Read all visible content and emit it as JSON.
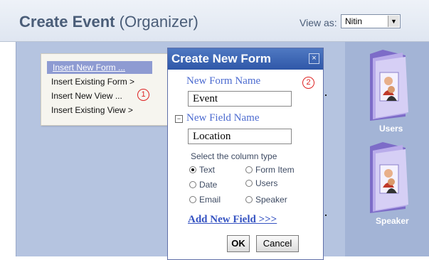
{
  "header": {
    "title_bold": "Create Event",
    "title_rest": " (Organizer)",
    "view_as_label": "View as:",
    "view_as_value": "Nitin"
  },
  "menu": {
    "items": [
      {
        "label": "Insert New Form ..."
      },
      {
        "label": "Insert Existing Form >"
      },
      {
        "label": "Insert New View ..."
      },
      {
        "label": "Insert Existing View >"
      }
    ],
    "callout": "1"
  },
  "dialog": {
    "title": "Create New Form",
    "close_glyph": "×",
    "callout": "2",
    "form_name_label": "New Form Name",
    "form_name_value": "Event",
    "field_name_label": "New Field Name",
    "field_name_value": "Location",
    "column_type_label": "Select the column type",
    "types": [
      {
        "label": "Text",
        "checked": true
      },
      {
        "label": "Form Item",
        "checked": false
      },
      {
        "label": "Date",
        "checked": false
      },
      {
        "label": "Users",
        "checked": false
      },
      {
        "label": "Email",
        "checked": false
      },
      {
        "label": "Speaker",
        "checked": false
      }
    ],
    "add_field_link": "Add New Field >>>",
    "ok_label": "OK",
    "cancel_label": "Cancel"
  },
  "sidebar": {
    "folders": [
      {
        "label": "Users",
        "icon": "users-folder-icon"
      },
      {
        "label": "Speaker",
        "icon": "speaker-folder-icon"
      }
    ]
  },
  "colors": {
    "accent": "#2f57a8",
    "workarea": "#b5c4e0",
    "link": "#3553c2",
    "callout": "#dd2222"
  }
}
